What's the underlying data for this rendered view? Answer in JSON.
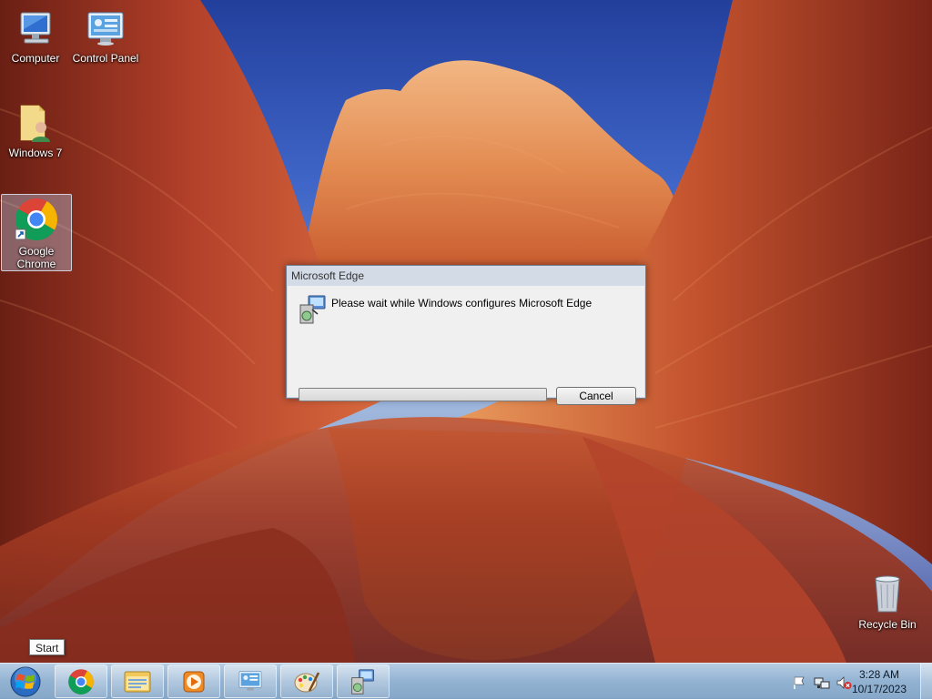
{
  "desktop": {
    "icons": [
      {
        "label": "Computer",
        "icon": "computer-icon"
      },
      {
        "label": "Control Panel",
        "icon": "control-panel-icon"
      },
      {
        "label": "Windows 7",
        "icon": "user-folder-icon"
      },
      {
        "label": "Google Chrome",
        "icon": "chrome-icon",
        "selected": true
      },
      {
        "label": "Recycle Bin",
        "icon": "recycle-bin-icon"
      }
    ]
  },
  "dialog": {
    "title": "Microsoft Edge",
    "message": "Please wait while Windows configures Microsoft Edge",
    "cancel_label": "Cancel",
    "progress_fraction": 0.0,
    "icon": "installer-setup-icon"
  },
  "start": {
    "tooltip": "Start",
    "icon": "windows-orb-icon"
  },
  "taskbar": {
    "pinned": [
      {
        "name": "chrome",
        "icon": "chrome-icon"
      },
      {
        "name": "explorer",
        "icon": "file-explorer-icon"
      },
      {
        "name": "media-player",
        "icon": "media-player-icon"
      },
      {
        "name": "control-panel",
        "icon": "control-panel-icon"
      },
      {
        "name": "paint",
        "icon": "paint-icon"
      },
      {
        "name": "installer",
        "icon": "installer-setup-icon"
      }
    ],
    "tray": {
      "icons": [
        "action-center-flag-icon",
        "network-icon",
        "volume-muted-icon"
      ],
      "time": "3:28 AM",
      "date": "10/17/2023"
    }
  },
  "colors": {
    "progress_fill": "#1ea83a",
    "taskbar": "#9cb9d7",
    "dialog_frame": "#d3dbe6"
  }
}
